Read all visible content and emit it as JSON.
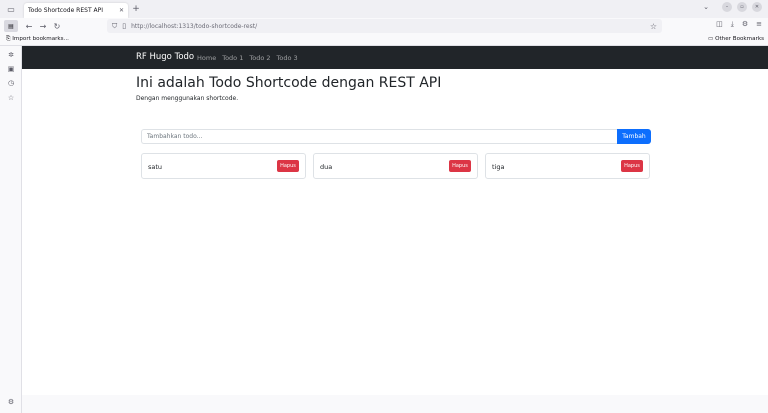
{
  "browser": {
    "tab_title": "Todo Shortcode REST API",
    "url_host": "http://localhost",
    "url_rest": ":1313/todo-shortcode-rest/",
    "bookmark_import": "Import bookmarks...",
    "bookmark_other": "Other Bookmarks"
  },
  "site": {
    "brand": "RF Hugo Todo",
    "nav": [
      "Home",
      "Todo 1",
      "Todo 2",
      "Todo 3"
    ],
    "heading": "Ini adalah Todo Shortcode dengan REST API",
    "lead": "Dengan menggunakan shortcode."
  },
  "form": {
    "placeholder": "Tambahkan todo...",
    "add_label": "Tambah"
  },
  "todos": [
    {
      "label": "satu",
      "delete_label": "Hapus"
    },
    {
      "label": "dua",
      "delete_label": "Hapus"
    },
    {
      "label": "tiga",
      "delete_label": "Hapus"
    }
  ],
  "colors": {
    "navbar": "#212529",
    "primary": "#0d6efd",
    "danger": "#dc3545"
  }
}
